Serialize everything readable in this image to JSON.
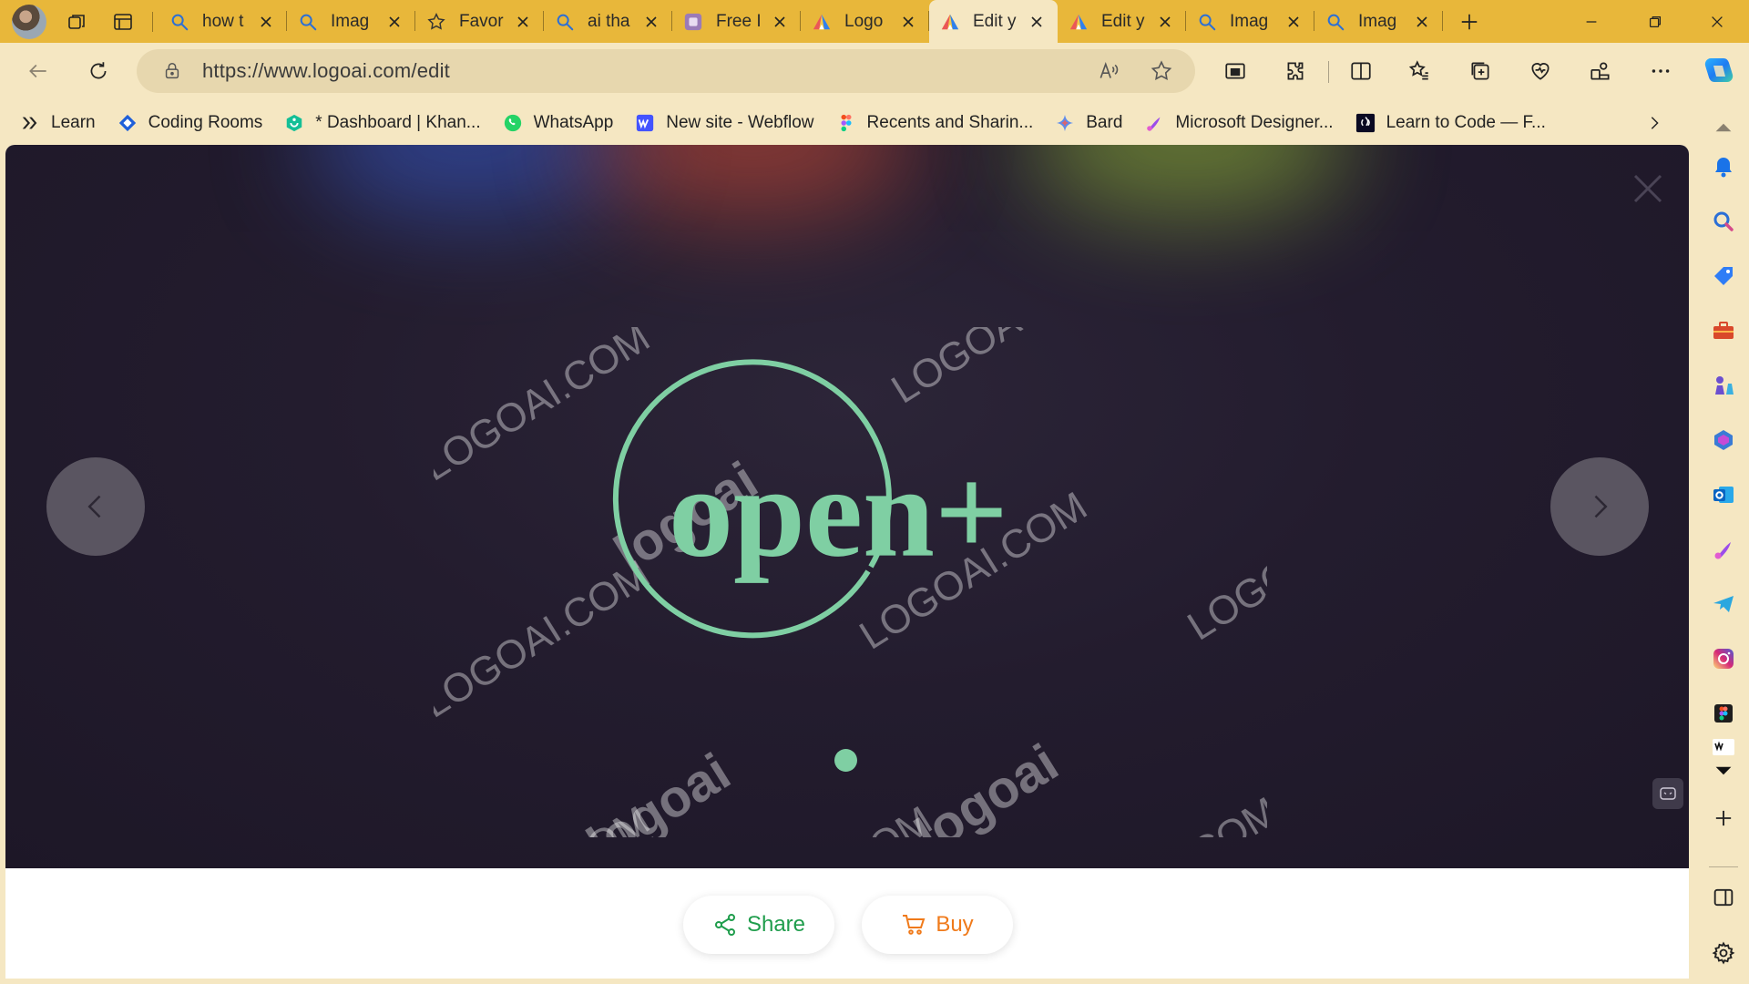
{
  "browser": {
    "tabs": [
      {
        "label": "how t",
        "icon": "search-icon",
        "active": false
      },
      {
        "label": "Imag",
        "icon": "search-icon",
        "active": false
      },
      {
        "label": "Favor",
        "icon": "star-icon",
        "active": false
      },
      {
        "label": "ai tha",
        "icon": "search-icon",
        "active": false
      },
      {
        "label": "Free I",
        "icon": "site-icon",
        "active": false
      },
      {
        "label": "Logo",
        "icon": "logoai-icon",
        "active": false
      },
      {
        "label": "Edit y",
        "icon": "logoai-icon",
        "active": true
      },
      {
        "label": "Edit y",
        "icon": "logoai-icon",
        "active": false
      },
      {
        "label": "Imag",
        "icon": "search-icon",
        "active": false
      },
      {
        "label": "Imag",
        "icon": "search-icon",
        "active": false
      }
    ],
    "url": "https://www.logoai.com/edit",
    "bookmarks": [
      {
        "label": "Learn",
        "icon": "learn-icon"
      },
      {
        "label": "Coding Rooms",
        "icon": "coding-rooms-icon"
      },
      {
        "label": "* Dashboard | Khan...",
        "icon": "khan-icon"
      },
      {
        "label": "WhatsApp",
        "icon": "whatsapp-icon"
      },
      {
        "label": "New site - Webflow",
        "icon": "webflow-icon"
      },
      {
        "label": "Recents and Sharin...",
        "icon": "figma-icon"
      },
      {
        "label": "Bard",
        "icon": "bard-icon"
      },
      {
        "label": "Microsoft Designer...",
        "icon": "designer-icon"
      },
      {
        "label": "Learn to Code — F...",
        "icon": "freecodecamp-icon"
      }
    ]
  },
  "preview": {
    "logo_text": "open+",
    "watermark_brand": "logoai",
    "watermark_domain": "LOGOAI.COM",
    "accent_color": "#7fcfa3",
    "background_color": "#231c2e"
  },
  "actions": {
    "share_label": "Share",
    "buy_label": "Buy",
    "share_color": "#1f9d4c",
    "buy_color": "#f07a1a"
  }
}
